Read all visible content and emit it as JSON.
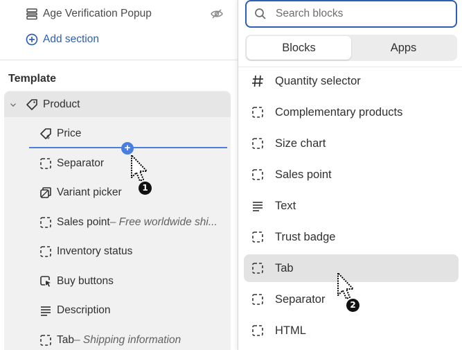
{
  "sections": {
    "age_popup": {
      "label": "Age Verification Popup",
      "icon": "section-icon",
      "visibility_icon": "eye-hidden-icon"
    },
    "add_section": {
      "label": "Add section",
      "icon": "plus-circle-icon"
    }
  },
  "template": {
    "title": "Template",
    "product": {
      "label": "Product",
      "icon": "tag-icon",
      "chevron": "chevron-down-icon"
    },
    "blocks": [
      {
        "label": "Price",
        "suffix": "",
        "icon": "price-tag-icon"
      },
      {
        "label": "Separator",
        "suffix": "",
        "icon": "dashed-square-icon"
      },
      {
        "label": "Variant picker",
        "suffix": "",
        "icon": "variant-icon"
      },
      {
        "label": "Sales point",
        "suffix": " – Free worldwide shi...",
        "icon": "dashed-square-icon"
      },
      {
        "label": "Inventory status",
        "suffix": "",
        "icon": "dashed-square-icon"
      },
      {
        "label": "Buy buttons",
        "suffix": "",
        "icon": "cursor-box-icon"
      },
      {
        "label": "Description",
        "suffix": "",
        "icon": "text-lines-icon"
      },
      {
        "label": "Tab",
        "suffix": " – Shipping information",
        "icon": "dashed-square-icon"
      }
    ]
  },
  "drop_marker": {
    "label": "1"
  },
  "picker": {
    "search_placeholder": "Search blocks",
    "tabs": [
      {
        "label": "Blocks",
        "active": true
      },
      {
        "label": "Apps",
        "active": false
      }
    ],
    "items": [
      {
        "label": "Quantity selector",
        "icon": "hash-icon"
      },
      {
        "label": "Complementary products",
        "icon": "dashed-square-icon"
      },
      {
        "label": "Size chart",
        "icon": "dashed-square-icon"
      },
      {
        "label": "Sales point",
        "icon": "dashed-square-icon"
      },
      {
        "label": "Text",
        "icon": "text-lines-icon"
      },
      {
        "label": "Trust badge",
        "icon": "dashed-square-icon"
      },
      {
        "label": "Tab",
        "icon": "dashed-square-icon",
        "highlighted": true
      },
      {
        "label": "Separator",
        "icon": "dashed-square-icon"
      },
      {
        "label": "HTML",
        "icon": "dashed-square-icon"
      }
    ]
  },
  "drag_marker": {
    "label": "2"
  },
  "colors": {
    "accent": "#2b5fb3",
    "insert_line": "#4a7fe0",
    "highlight": "#e3e3e3"
  }
}
